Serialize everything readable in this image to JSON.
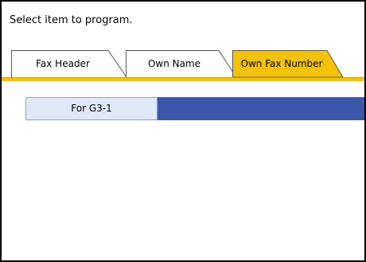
{
  "instruction": "Select item to program.",
  "tabs": [
    {
      "label": "Fax Header",
      "selected": false
    },
    {
      "label": "Own Name",
      "selected": false
    },
    {
      "label": "Own Fax Number",
      "selected": true
    }
  ],
  "items": [
    {
      "label": "For G3-1",
      "value": ""
    }
  ],
  "colors": {
    "selected_tab": "#f5c20a",
    "tab_background": "#ffffff",
    "item_button": "#dfe8f6",
    "item_value_field": "#3b57a8"
  }
}
